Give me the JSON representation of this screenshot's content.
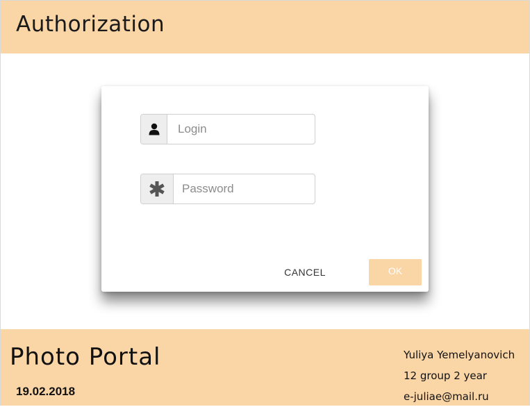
{
  "header": {
    "title": "Authorization"
  },
  "dialog": {
    "login": {
      "placeholder": "Login",
      "value": "",
      "icon": "user-icon"
    },
    "password": {
      "placeholder": "Password",
      "value": "",
      "icon": "asterisk-icon"
    },
    "cancel_label": "CANCEL",
    "ok_label": "OK"
  },
  "footer": {
    "brand": "Photo Portal",
    "date": "19.02.2018",
    "author_name": "Yuliya Yemelyanovich",
    "author_group": "12 group 2 year",
    "author_email": "e-juliae@mail.ru"
  },
  "colors": {
    "accent": "#fad5a6",
    "addon_bg": "#eeeeee"
  }
}
